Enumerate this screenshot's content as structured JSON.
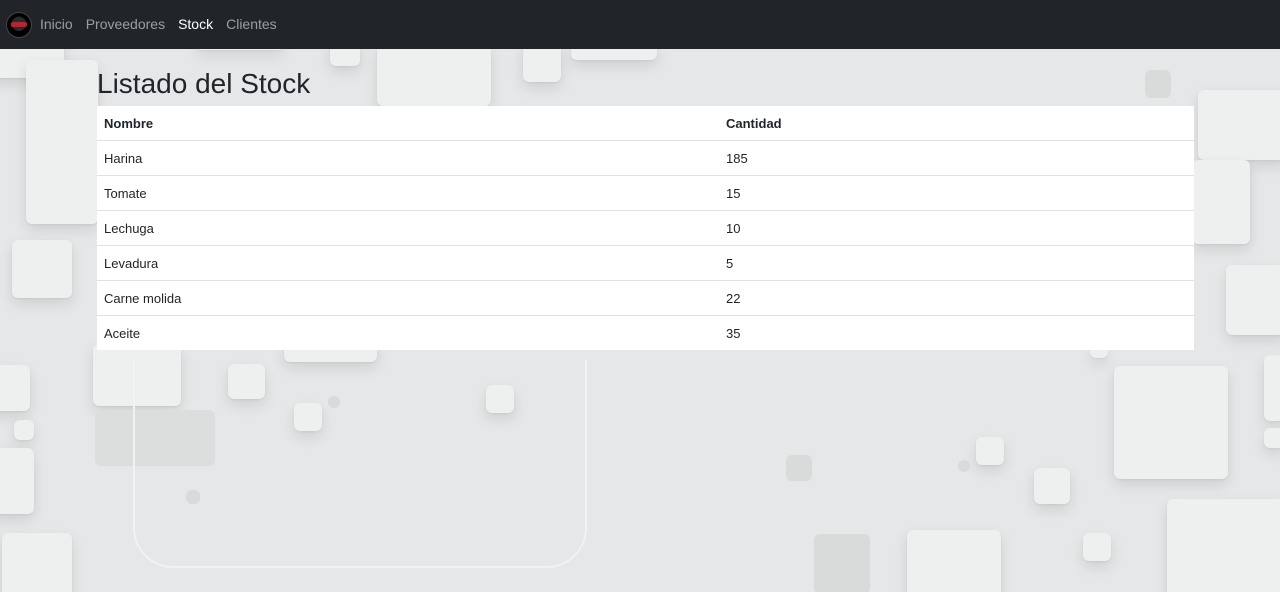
{
  "navbar": {
    "brand_icon": "brand-logo-icon",
    "links": [
      {
        "label": "Inicio",
        "active": false
      },
      {
        "label": "Proveedores",
        "active": false
      },
      {
        "label": "Stock",
        "active": true
      },
      {
        "label": "Clientes",
        "active": false
      }
    ]
  },
  "main": {
    "title": "Listado del Stock",
    "table": {
      "headers": [
        "Nombre",
        "Cantidad"
      ],
      "rows": [
        [
          "Harina",
          "185"
        ],
        [
          "Tomate",
          "15"
        ],
        [
          "Lechuga",
          "10"
        ],
        [
          "Levadura",
          "5"
        ],
        [
          "Carne molida",
          "22"
        ],
        [
          "Aceite",
          "35"
        ]
      ]
    }
  },
  "colors": {
    "navbar_bg": "#212529",
    "nav_active": "#ffffff",
    "nav_inactive": "rgba(255,255,255,0.55)",
    "background": "#e6e7e8"
  }
}
